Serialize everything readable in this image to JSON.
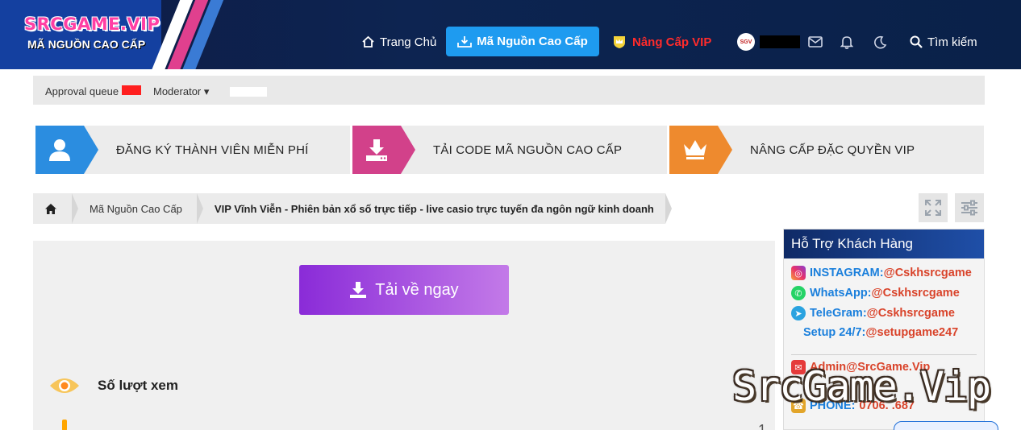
{
  "header": {
    "logo_title": "SRCGAME.VIP",
    "logo_subtitle": "MÃ NGUỒN CAO CẤP",
    "nav": {
      "home": "Trang Chủ",
      "premium_source": "Mã Nguồn Cao Cấp",
      "upgrade_vip": "Nâng Cấp VIP",
      "avatar_text": "SGV",
      "search": "Tìm kiếm"
    }
  },
  "adminbar": {
    "approval_queue": "Approval queue",
    "moderator": "Moderator ▾"
  },
  "features": [
    {
      "label": "ĐĂNG KÝ THÀNH VIÊN MIỄN PHÍ",
      "icon": "user-icon"
    },
    {
      "label": "TẢI CODE MÃ NGUỒN CAO CẤP",
      "icon": "download-icon"
    },
    {
      "label": "NÂNG CẤP ĐẶC QUYỀN VIP",
      "icon": "crown-icon"
    }
  ],
  "breadcrumb": {
    "items": [
      "Mã Nguồn Cao Cấp",
      "VIP Vĩnh Viễn - Phiên bản xổ số trực tiếp - live casio trực tuyến đa ngôn ngữ kinh doanh"
    ]
  },
  "main": {
    "download_label": "Tải về ngay",
    "views_label": "Số lượt xem",
    "row2_value": "1"
  },
  "sidebar": {
    "title": "Hỗ Trợ Khách Hàng",
    "instagram_key": "INSTAGRAM:",
    "instagram_val": "@Cskhsrcgame",
    "whatsapp_key": "WhatsApp:",
    "whatsapp_val": "@Cskhsrcgame",
    "telegram_key": "TeleGram:",
    "telegram_val": "@Cskhsrcgame",
    "setup_key": "Setup 24/7:",
    "setup_val": "@setupgame247",
    "admin": "Admin@SrcGame.Vip",
    "phone_key": "PHONE:",
    "phone_val": "0706.  .687"
  },
  "watermark": "SrcGame.Vip",
  "colors": {
    "header_bg": "#0d2451",
    "nav_active": "#1e9bf0",
    "vip_red": "#ff2b2b",
    "download_gradient_start": "#8a2bd8",
    "download_gradient_end": "#c37ae8"
  }
}
